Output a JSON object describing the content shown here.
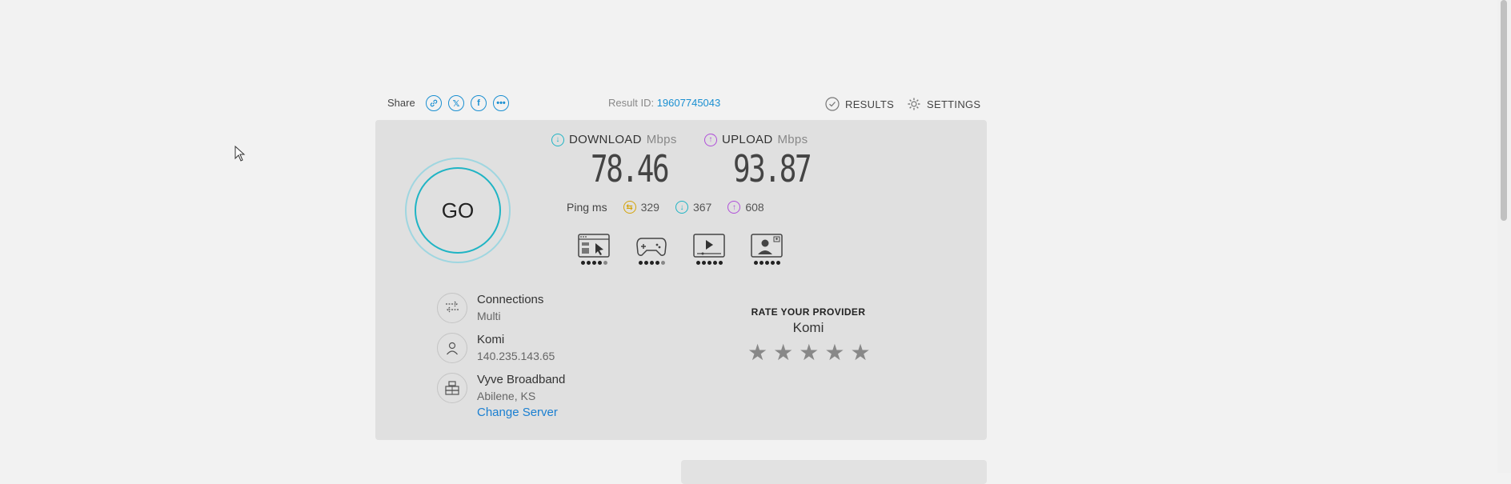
{
  "header": {
    "share_label": "Share",
    "share_icons": [
      "link-icon",
      "x-icon",
      "facebook-icon",
      "more-icon"
    ],
    "result_id_label": "Result ID:",
    "result_id_value": "19607745043",
    "results_label": "RESULTS",
    "settings_label": "SETTINGS"
  },
  "go_button": {
    "label": "GO"
  },
  "download": {
    "label": "DOWNLOAD",
    "unit": "Mbps",
    "value": "78.46",
    "color": "#1fb4c4"
  },
  "upload": {
    "label": "UPLOAD",
    "unit": "Mbps",
    "value": "93.87",
    "color": "#b04fd9"
  },
  "ping": {
    "label": "Ping",
    "unit": "ms",
    "idle": "329",
    "download": "367",
    "upload": "608",
    "idle_color": "#d4a40a"
  },
  "quality_icons": [
    {
      "name": "web-browsing-icon",
      "dots_filled": 4,
      "dots_total": 5
    },
    {
      "name": "gaming-icon",
      "dots_filled": 4,
      "dots_total": 5
    },
    {
      "name": "video-streaming-icon",
      "dots_filled": 5,
      "dots_total": 5
    },
    {
      "name": "video-chat-icon",
      "dots_filled": 5,
      "dots_total": 5
    }
  ],
  "connection": {
    "connections_title": "Connections",
    "connections_value": "Multi",
    "isp_name": "Komi",
    "ip": "140.235.143.65",
    "server_name": "Vyve Broadband",
    "server_location": "Abilene, KS",
    "change_server": "Change Server"
  },
  "rating": {
    "title": "RATE YOUR PROVIDER",
    "provider": "Komi",
    "stars_total": 5
  }
}
